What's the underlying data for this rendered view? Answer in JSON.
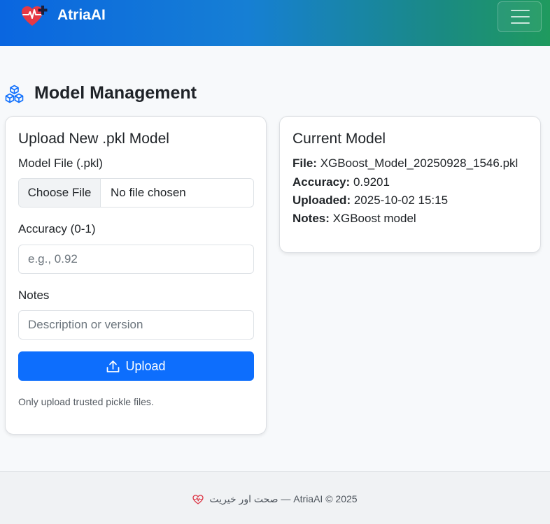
{
  "navbar": {
    "brand": "AtriaAI",
    "brand_icon": "heart-pulse-plus-icon",
    "toggler_icon": "hamburger-icon"
  },
  "page": {
    "title": "Model Management",
    "title_icon": "boxes-icon"
  },
  "upload_card": {
    "title": "Upload New .pkl Model",
    "file_label": "Model File (.pkl)",
    "file_button": "Choose File",
    "file_status": "No file chosen",
    "accuracy_label": "Accuracy (0-1)",
    "accuracy_placeholder": "e.g., 0.92",
    "accuracy_value": "",
    "notes_label": "Notes",
    "notes_placeholder": "Description or version",
    "notes_value": "",
    "upload_button": "Upload",
    "upload_icon": "upload-icon",
    "hint": "Only upload trusted pickle files."
  },
  "current_card": {
    "title": "Current Model",
    "file_key": "File:",
    "file_value": "XGBoost_Model_20250928_1546.pkl",
    "accuracy_key": "Accuracy:",
    "accuracy_value": "0.9201",
    "uploaded_key": "Uploaded:",
    "uploaded_value": "2025-10-02 15:15",
    "notes_key": "Notes:",
    "notes_value": "XGBoost model"
  },
  "footer": {
    "text": "صحت اور خیریت — AtriaAI © 2025",
    "icon": "heart-pulse-icon"
  },
  "colors": {
    "navbar_start": "#0a66e0",
    "navbar_end": "#1f9a5e",
    "primary": "#0d6efd",
    "brand_heart": "#e63946",
    "footer_heart": "#dc3545"
  }
}
